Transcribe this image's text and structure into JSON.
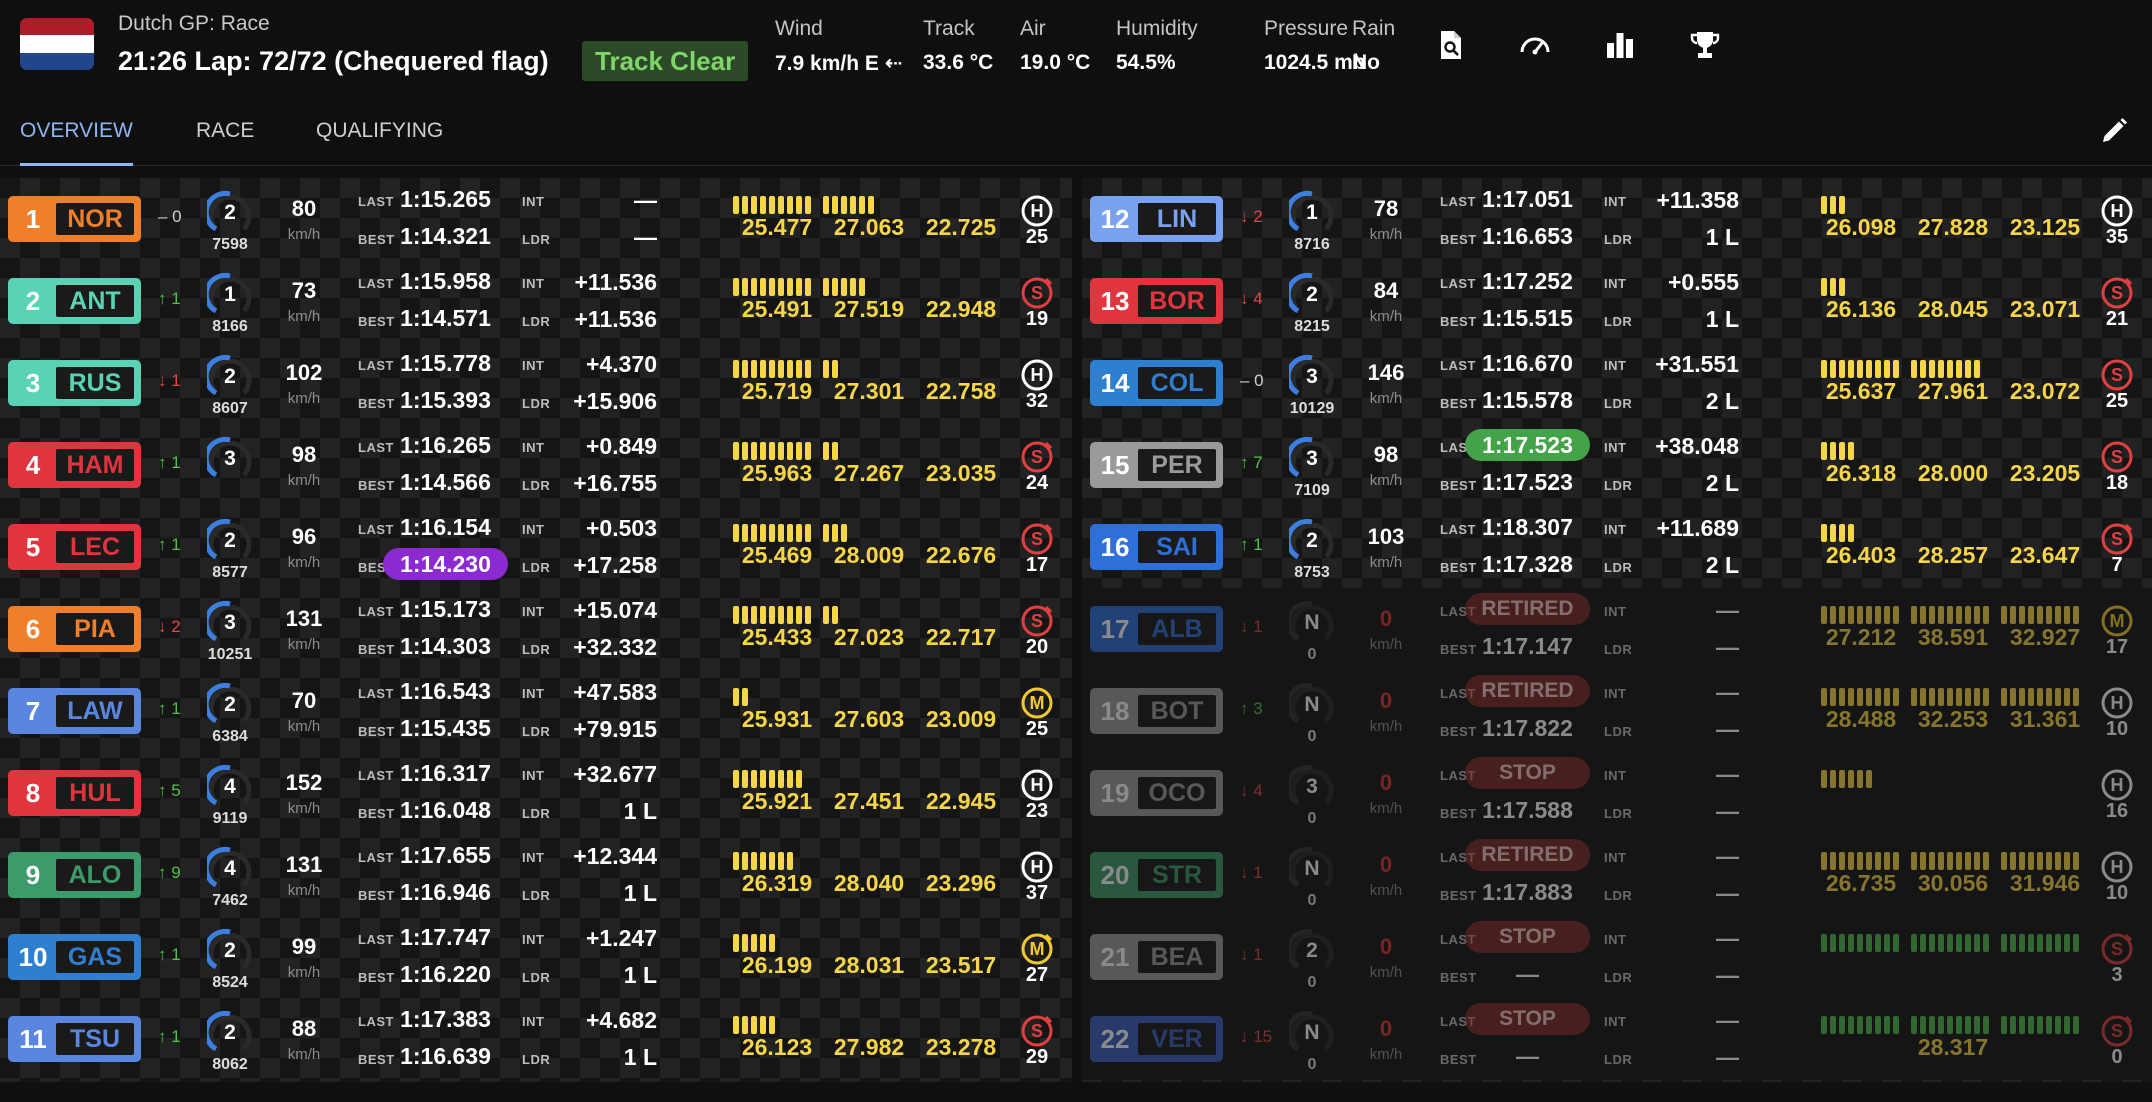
{
  "header": {
    "race_name": "Dutch GP: Race",
    "race_status": "21:26 Lap: 72/72 (Chequered flag)",
    "track_status": "Track Clear",
    "flag_colors": [
      "#ae1c28",
      "#ffffff",
      "#21468b"
    ],
    "weather": [
      {
        "label": "Wind",
        "value": "7.9 km/h E ⇠"
      },
      {
        "label": "Track",
        "value": "33.6 °C"
      },
      {
        "label": "Air",
        "value": "19.0 °C"
      },
      {
        "label": "Humidity",
        "value": "54.5%"
      },
      {
        "label": "Pressure",
        "value": "1024.5 mb"
      },
      {
        "label": "Rain",
        "value": "No"
      }
    ],
    "icons": [
      "search-document-icon",
      "speedometer-icon",
      "bar-chart-icon",
      "trophy-icon"
    ]
  },
  "tabs": [
    "OVERVIEW",
    "RACE",
    "QUALIFYING"
  ],
  "active_tab": "OVERVIEW",
  "labels": {
    "last": "LAST",
    "best": "BEST",
    "int": "INT",
    "ldr": "LDR",
    "kmh": "km/h"
  },
  "colors": {
    "sector_yellow": "#f5d54a",
    "sector_green": "#4fb84c",
    "sector_blue": "#3a6fd8",
    "sector_red": "#d93a3a",
    "gear_arc": "#3d7fe0"
  },
  "drivers": [
    {
      "pos": "1",
      "code": "NOR",
      "team_color": "#ef7f2a",
      "change": "– 0",
      "dir": "eq",
      "gear": "2",
      "rpm": "7598",
      "speed": "80",
      "last": "1:15.265",
      "best": "1:14.321",
      "last_style": "",
      "best_style": "",
      "int": "—",
      "ldr": "—",
      "mini": [
        {
          "count": 9,
          "color": "y"
        },
        {
          "count": 6,
          "color": "y"
        }
      ],
      "sectors": [
        "25.477",
        "27.063",
        "22.725"
      ],
      "tyre": "H",
      "tyre_color": "#ffffff",
      "tyre_new": false,
      "laps": "25",
      "out": false
    },
    {
      "pos": "2",
      "code": "ANT",
      "team_color": "#5ad2b4",
      "change": "↑ 1",
      "dir": "up",
      "gear": "1",
      "rpm": "8166",
      "speed": "73",
      "last": "1:15.958",
      "best": "1:14.571",
      "last_style": "",
      "best_style": "",
      "int": "+11.536",
      "ldr": "+11.536",
      "mini": [
        {
          "count": 9,
          "color": "y"
        },
        {
          "count": 5,
          "color": "y"
        }
      ],
      "sectors": [
        "25.491",
        "27.519",
        "22.948"
      ],
      "tyre": "S",
      "tyre_color": "#e04040",
      "tyre_new": true,
      "laps": "19",
      "out": false
    },
    {
      "pos": "3",
      "code": "RUS",
      "team_color": "#5ad2b4",
      "change": "↓ 1",
      "dir": "down",
      "gear": "2",
      "rpm": "8607",
      "speed": "102",
      "last": "1:15.778",
      "best": "1:15.393",
      "last_style": "",
      "best_style": "",
      "int": "+4.370",
      "ldr": "+15.906",
      "mini": [
        {
          "count": 9,
          "color": "y"
        },
        {
          "count": 2,
          "color": "y"
        }
      ],
      "sectors": [
        "25.719",
        "27.301",
        "22.758"
      ],
      "tyre": "H",
      "tyre_color": "#ffffff",
      "tyre_new": false,
      "laps": "32",
      "out": false
    },
    {
      "pos": "4",
      "code": "HAM",
      "team_color": "#e0353f",
      "change": "↑ 1",
      "dir": "up",
      "gear": "3",
      "rpm": "",
      "speed": "98",
      "last": "1:16.265",
      "best": "1:14.566",
      "last_style": "",
      "best_style": "",
      "int": "+0.849",
      "ldr": "+16.755",
      "mini": [
        {
          "count": 9,
          "color": "y"
        },
        {
          "count": 2,
          "color": "y"
        }
      ],
      "sectors": [
        "25.963",
        "27.267",
        "23.035"
      ],
      "tyre": "S",
      "tyre_color": "#e04040",
      "tyre_new": true,
      "laps": "24",
      "out": false
    },
    {
      "pos": "5",
      "code": "LEC",
      "team_color": "#e0353f",
      "change": "↑ 1",
      "dir": "up",
      "gear": "2",
      "rpm": "8577",
      "speed": "96",
      "last": "1:16.154",
      "best": "1:14.230",
      "last_style": "",
      "best_style": "purple",
      "int": "+0.503",
      "ldr": "+17.258",
      "mini": [
        {
          "count": 9,
          "color": "y"
        },
        {
          "count": 3,
          "color": "y"
        }
      ],
      "sectors": [
        "25.469",
        "28.009",
        "22.676"
      ],
      "tyre": "S",
      "tyre_color": "#e04040",
      "tyre_new": true,
      "laps": "17",
      "out": false
    },
    {
      "pos": "6",
      "code": "PIA",
      "team_color": "#ef7f2a",
      "change": "↓ 2",
      "dir": "down",
      "gear": "3",
      "rpm": "10251",
      "speed": "131",
      "last": "1:15.173",
      "best": "1:14.303",
      "last_style": "",
      "best_style": "",
      "int": "+15.074",
      "ldr": "+32.332",
      "mini": [
        {
          "count": 9,
          "color": "y"
        },
        {
          "count": 2,
          "color": "y"
        }
      ],
      "sectors": [
        "25.433",
        "27.023",
        "22.717"
      ],
      "tyre": "S",
      "tyre_color": "#e04040",
      "tyre_new": true,
      "laps": "20",
      "out": false
    },
    {
      "pos": "7",
      "code": "LAW",
      "team_color": "#5b86e0",
      "change": "↑ 1",
      "dir": "up",
      "gear": "2",
      "rpm": "6384",
      "speed": "70",
      "last": "1:16.543",
      "best": "1:15.435",
      "last_style": "",
      "best_style": "",
      "int": "+47.583",
      "ldr": "+79.915",
      "mini": [
        {
          "count": 2,
          "color": "y"
        }
      ],
      "sectors": [
        "25.931",
        "27.603",
        "23.009"
      ],
      "tyre": "M",
      "tyre_color": "#f2c830",
      "tyre_new": false,
      "laps": "25",
      "out": false
    },
    {
      "pos": "8",
      "code": "HUL",
      "team_color": "#e0353f",
      "change": "↑ 5",
      "dir": "up",
      "gear": "4",
      "rpm": "9119",
      "speed": "152",
      "last": "1:16.317",
      "best": "1:16.048",
      "last_style": "",
      "best_style": "",
      "int": "+32.677",
      "ldr": "1 L",
      "mini": [
        {
          "count": 8,
          "color": "y"
        }
      ],
      "sectors": [
        "25.921",
        "27.451",
        "22.945"
      ],
      "tyre": "H",
      "tyre_color": "#ffffff",
      "tyre_new": false,
      "laps": "23",
      "out": false
    },
    {
      "pos": "9",
      "code": "ALO",
      "team_color": "#3d9a6a",
      "change": "↑ 9",
      "dir": "up",
      "gear": "4",
      "rpm": "7462",
      "speed": "131",
      "last": "1:17.655",
      "best": "1:16.946",
      "last_style": "",
      "best_style": "",
      "int": "+12.344",
      "ldr": "1 L",
      "mini": [
        {
          "count": 7,
          "color": "y"
        }
      ],
      "sectors": [
        "26.319",
        "28.040",
        "23.296"
      ],
      "tyre": "H",
      "tyre_color": "#ffffff",
      "tyre_new": false,
      "laps": "37",
      "out": false
    },
    {
      "pos": "10",
      "code": "GAS",
      "team_color": "#2f7fd0",
      "change": "↑ 1",
      "dir": "up",
      "gear": "2",
      "rpm": "8524",
      "speed": "99",
      "last": "1:17.747",
      "best": "1:16.220",
      "last_style": "",
      "best_style": "",
      "int": "+1.247",
      "ldr": "1 L",
      "mini": [
        {
          "count": 5,
          "color": "y"
        }
      ],
      "sectors": [
        "26.199",
        "28.031",
        "23.517"
      ],
      "tyre": "M",
      "tyre_color": "#f2c830",
      "tyre_new": true,
      "laps": "27",
      "out": false
    },
    {
      "pos": "11",
      "code": "TSU",
      "team_color": "#5b86e0",
      "change": "↑ 1",
      "dir": "up",
      "gear": "2",
      "rpm": "8062",
      "speed": "88",
      "last": "1:17.383",
      "best": "1:16.639",
      "last_style": "",
      "best_style": "",
      "int": "+4.682",
      "ldr": "1 L",
      "mini": [
        {
          "count": 5,
          "color": "y"
        }
      ],
      "sectors": [
        "26.123",
        "27.982",
        "23.278"
      ],
      "tyre": "S",
      "tyre_color": "#e04040",
      "tyre_new": true,
      "laps": "29",
      "out": false
    },
    {
      "pos": "12",
      "code": "LIN",
      "team_color": "#7aa0f0",
      "change": "↓ 2",
      "dir": "down",
      "gear": "1",
      "rpm": "8716",
      "speed": "78",
      "last": "1:17.051",
      "best": "1:16.653",
      "last_style": "",
      "best_style": "",
      "int": "+11.358",
      "ldr": "1 L",
      "mini": [
        {
          "count": 3,
          "color": "y"
        }
      ],
      "sectors": [
        "26.098",
        "27.828",
        "23.125"
      ],
      "tyre": "H",
      "tyre_color": "#ffffff",
      "tyre_new": false,
      "laps": "35",
      "out": false
    },
    {
      "pos": "13",
      "code": "BOR",
      "team_color": "#e0353f",
      "change": "↓ 4",
      "dir": "down",
      "gear": "2",
      "rpm": "8215",
      "speed": "84",
      "last": "1:17.252",
      "best": "1:15.515",
      "last_style": "",
      "best_style": "",
      "int": "+0.555",
      "ldr": "1 L",
      "mini": [
        {
          "count": 3,
          "color": "y"
        }
      ],
      "sectors": [
        "26.136",
        "28.045",
        "23.071"
      ],
      "tyre": "S",
      "tyre_color": "#e04040",
      "tyre_new": true,
      "laps": "21",
      "out": false
    },
    {
      "pos": "14",
      "code": "COL",
      "team_color": "#2f7fd0",
      "change": "– 0",
      "dir": "eq",
      "gear": "3",
      "rpm": "10129",
      "speed": "146",
      "last": "1:16.670",
      "best": "1:15.578",
      "last_style": "",
      "best_style": "",
      "int": "+31.551",
      "ldr": "2 L",
      "mini": [
        {
          "count": 9,
          "color": "y"
        },
        {
          "count": 8,
          "color": "y"
        }
      ],
      "sectors": [
        "25.637",
        "27.961",
        "23.072"
      ],
      "tyre": "S",
      "tyre_color": "#e04040",
      "tyre_new": false,
      "laps": "25",
      "out": false
    },
    {
      "pos": "15",
      "code": "PER",
      "team_color": "#9a9a9a",
      "change": "↑ 7",
      "dir": "up",
      "gear": "3",
      "rpm": "7109",
      "speed": "98",
      "last": "1:17.523",
      "best": "1:17.523",
      "last_style": "green",
      "best_style": "",
      "int": "+38.048",
      "ldr": "2 L",
      "mini": [
        {
          "count": 4,
          "color": "y"
        }
      ],
      "sectors": [
        "26.318",
        "28.000",
        "23.205"
      ],
      "tyre": "S",
      "tyre_color": "#e04040",
      "tyre_new": false,
      "laps": "18",
      "out": false
    },
    {
      "pos": "16",
      "code": "SAI",
      "team_color": "#2f6fd8",
      "change": "↑ 1",
      "dir": "up",
      "gear": "2",
      "rpm": "8753",
      "speed": "103",
      "last": "1:18.307",
      "best": "1:17.328",
      "last_style": "",
      "best_style": "",
      "int": "+11.689",
      "ldr": "2 L",
      "mini": [
        {
          "count": 4,
          "color": "y"
        }
      ],
      "sectors": [
        "26.403",
        "28.257",
        "23.647"
      ],
      "tyre": "S",
      "tyre_color": "#e04040",
      "tyre_new": true,
      "laps": "7",
      "out": false
    },
    {
      "pos": "17",
      "code": "ALB",
      "team_color": "#2f6fd8",
      "change": "↓ 1",
      "dir": "down",
      "gear": "N",
      "rpm": "0",
      "speed": "0",
      "last": "RETIRED",
      "best": "1:17.147",
      "last_style": "red",
      "best_style": "",
      "int": "—",
      "ldr": "—",
      "mini": [
        {
          "count": 9,
          "color": "y"
        },
        {
          "count": 9,
          "color": "y"
        },
        {
          "count": 9,
          "color": "y"
        }
      ],
      "sectors": [
        "27.212",
        "38.591",
        "32.927"
      ],
      "tyre": "M",
      "tyre_color": "#f2c830",
      "tyre_new": false,
      "laps": "17",
      "out": true
    },
    {
      "pos": "18",
      "code": "BOT",
      "team_color": "#9a9a9a",
      "change": "↑ 3",
      "dir": "up",
      "gear": "N",
      "rpm": "0",
      "speed": "0",
      "last": "RETIRED",
      "best": "1:17.822",
      "last_style": "red",
      "best_style": "",
      "int": "—",
      "ldr": "—",
      "mini": [
        {
          "count": 9,
          "color": "y"
        },
        {
          "count": 9,
          "color": "y"
        },
        {
          "count": 9,
          "color": "y"
        }
      ],
      "sectors": [
        "28.488",
        "32.253",
        "31.361"
      ],
      "tyre": "H",
      "tyre_color": "#ffffff",
      "tyre_new": false,
      "laps": "10",
      "out": true
    },
    {
      "pos": "19",
      "code": "OCO",
      "team_color": "#9a9a9a",
      "change": "↓ 4",
      "dir": "down",
      "gear": "3",
      "rpm": "0",
      "speed": "0",
      "last": "STOP",
      "best": "1:17.588",
      "last_style": "red",
      "best_style": "",
      "int": "—",
      "ldr": "—",
      "mini": [
        {
          "count": 6,
          "color": "y"
        }
      ],
      "sectors": [
        "",
        "",
        ""
      ],
      "tyre": "H",
      "tyre_color": "#ffffff",
      "tyre_new": false,
      "laps": "16",
      "out": true
    },
    {
      "pos": "20",
      "code": "STR",
      "team_color": "#3d9a6a",
      "change": "↓ 1",
      "dir": "down",
      "gear": "N",
      "rpm": "0",
      "speed": "0",
      "last": "RETIRED",
      "best": "1:17.883",
      "last_style": "red",
      "best_style": "",
      "int": "—",
      "ldr": "—",
      "mini": [
        {
          "count": 9,
          "color": "y"
        },
        {
          "count": 9,
          "color": "y"
        },
        {
          "count": 9,
          "color": "y"
        }
      ],
      "sectors": [
        "26.735",
        "30.056",
        "31.946"
      ],
      "tyre": "H",
      "tyre_color": "#ffffff",
      "tyre_new": false,
      "laps": "10",
      "out": true
    },
    {
      "pos": "21",
      "code": "BEA",
      "team_color": "#9a9a9a",
      "change": "↓ 1",
      "dir": "down",
      "gear": "2",
      "rpm": "0",
      "speed": "0",
      "last": "STOP",
      "best": "—",
      "last_style": "red",
      "best_style": "",
      "int": "—",
      "ldr": "—",
      "mini": [
        {
          "count": 9,
          "color": "g"
        },
        {
          "count": 9,
          "color": "g"
        },
        {
          "count": 9,
          "color": "g"
        }
      ],
      "sectors": [
        "",
        "",
        ""
      ],
      "tyre": "S",
      "tyre_color": "#e04040",
      "tyre_new": true,
      "laps": "3",
      "out": true
    },
    {
      "pos": "22",
      "code": "VER",
      "team_color": "#3a5fc0",
      "change": "↓ 15",
      "dir": "down",
      "gear": "N",
      "rpm": "0",
      "speed": "0",
      "last": "STOP",
      "best": "—",
      "last_style": "red",
      "best_style": "",
      "int": "—",
      "ldr": "—",
      "mini": [
        {
          "count": 9,
          "color": "g"
        },
        {
          "count": 9,
          "color": "g"
        },
        {
          "count": 9,
          "color": "g"
        }
      ],
      "sectors": [
        "",
        "28.317",
        ""
      ],
      "tyre": "S",
      "tyre_color": "#e04040",
      "tyre_new": true,
      "laps": "0",
      "out": true
    }
  ]
}
